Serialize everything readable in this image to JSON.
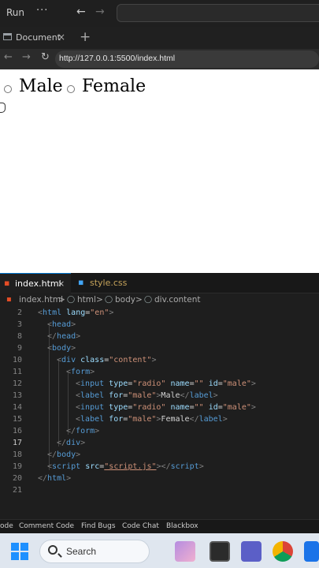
{
  "titlebar": {
    "run_label": "Run",
    "more_label": "···",
    "back_arrow": "←",
    "forward_arrow": "→"
  },
  "browser": {
    "tab_title": "Document",
    "tab_close": "×",
    "new_tab": "+",
    "back": "←",
    "forward": "→",
    "reload": "↻",
    "url": "http://127.0.0.1:5500/index.html"
  },
  "page": {
    "options": [
      {
        "label": "Male",
        "checked": false
      },
      {
        "label": "Female",
        "checked": false
      }
    ]
  },
  "editor": {
    "tabs": [
      {
        "name": "index.html",
        "icon": "html-file-icon",
        "close": "×",
        "active": true
      },
      {
        "name": "style.css",
        "icon": "css-file-icon",
        "active": false
      }
    ],
    "breadcrumb": [
      "index.html",
      ">",
      "html",
      ">",
      "body",
      ">",
      "div.content"
    ],
    "current_line": "17",
    "lines": [
      {
        "n": "2"
      },
      {
        "n": "3"
      },
      {
        "n": "8"
      },
      {
        "n": "9"
      },
      {
        "n": "10"
      },
      {
        "n": "11"
      },
      {
        "n": "12"
      },
      {
        "n": "13"
      },
      {
        "n": "14"
      },
      {
        "n": "15"
      },
      {
        "n": "16"
      },
      {
        "n": "17"
      },
      {
        "n": "18"
      },
      {
        "n": "19"
      },
      {
        "n": "20"
      },
      {
        "n": "21"
      }
    ],
    "tokens": {
      "open": "<",
      "close": ">",
      "end_open": "</",
      "self_close": "/>",
      "html": "html",
      "head": "head",
      "body": "body",
      "div": "div",
      "form": "form",
      "input": "input",
      "label": "label",
      "script": "script",
      "lang": "lang",
      "class": "class",
      "type": "type",
      "name": "name",
      "id": "id",
      "for": "for",
      "src": "src",
      "eq": "=",
      "v_en": "\"en\"",
      "v_content": "\"content\"",
      "v_radio": "\"radio\"",
      "v_empty": "\"\"",
      "v_male": "\"male\"",
      "v_script": "\"script.js\"",
      "t_male": "Male",
      "t_female": "Female"
    }
  },
  "statusbar": {
    "items": [
      "ode",
      "Comment Code",
      "Find Bugs",
      "Code Chat",
      "Blackbox"
    ]
  },
  "taskbar": {
    "search_label": "Search"
  }
}
